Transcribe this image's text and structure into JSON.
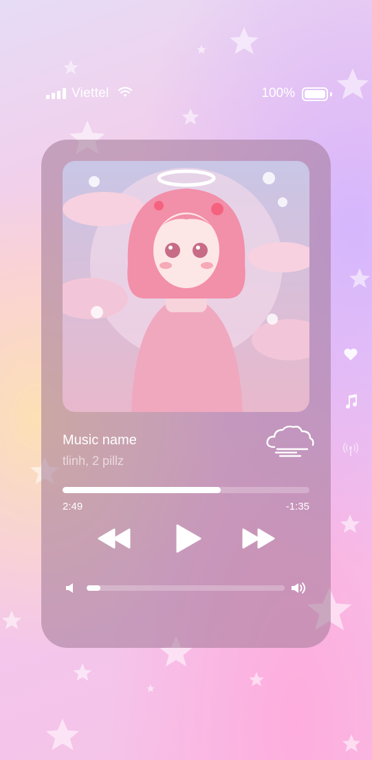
{
  "status_bar": {
    "carrier": "Viettel",
    "battery_percent": "100%",
    "battery_level": 1.0,
    "signal_icon": "cellular-signal-icon",
    "wifi_icon": "wifi-icon"
  },
  "player": {
    "song_title": "Music name",
    "artist": "tlinh, 2 pillz",
    "time_elapsed": "2:49",
    "time_remaining": "-1:35",
    "progress": 0.64,
    "volume": 0.07,
    "weather_icon": "windy-cloud-icon",
    "controls": {
      "rewind_icon": "rewind-icon",
      "play_icon": "play-icon",
      "forward_icon": "fast-forward-icon"
    }
  },
  "side_icons": [
    "heart-icon",
    "music-note-icon",
    "broadcast-icon"
  ],
  "colors": {
    "card": "#a07896",
    "accent": "#ffffff"
  }
}
